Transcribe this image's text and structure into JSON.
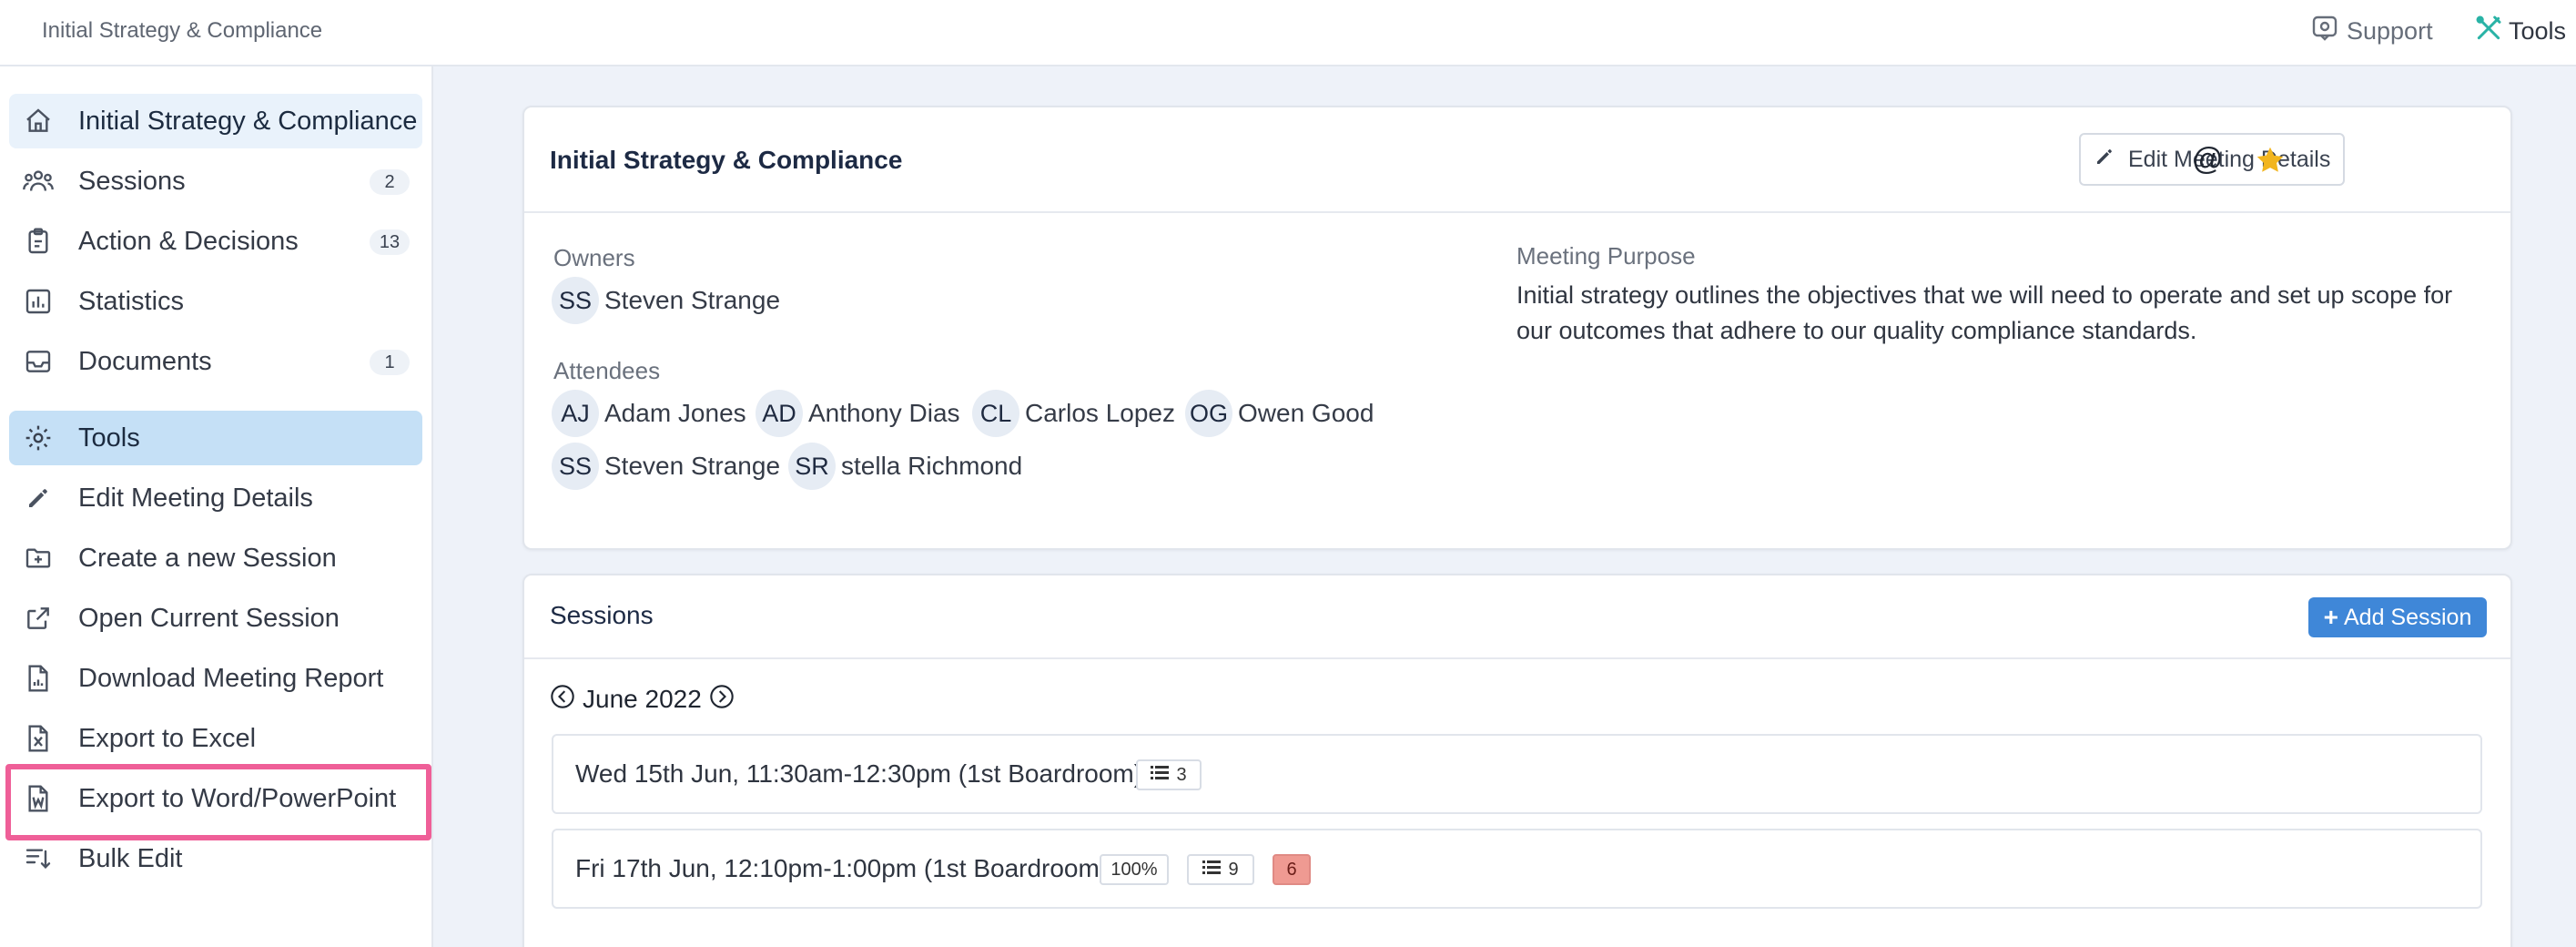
{
  "app": {
    "title": "Initial Strategy & Compliance"
  },
  "topbar": {
    "support_label": "Support",
    "tools_label": "Tools"
  },
  "sidebar": {
    "main_items": [
      {
        "label": "Initial Strategy & Compliance",
        "icon": "home-icon"
      },
      {
        "label": "Sessions",
        "count": "2",
        "icon": "people-icon"
      },
      {
        "label": "Action & Decisions",
        "count": "13",
        "icon": "clipboard-icon"
      },
      {
        "label": "Statistics",
        "icon": "chart-icon"
      },
      {
        "label": "Documents",
        "count": "1",
        "icon": "inbox-icon"
      }
    ],
    "tools_header": {
      "label": "Tools",
      "icon": "gear-icon"
    },
    "tool_items": [
      {
        "label": "Edit Meeting Details",
        "icon": "pencil-icon"
      },
      {
        "label": "Create a new Session",
        "icon": "folder-plus-icon"
      },
      {
        "label": "Open Current Session",
        "icon": "external-link-icon"
      },
      {
        "label": "Download Meeting Report",
        "icon": "report-icon"
      },
      {
        "label": "Export to Excel",
        "icon": "excel-file-icon"
      },
      {
        "label": "Export to Word/PowerPoint",
        "icon": "word-file-icon"
      },
      {
        "label": "Bulk Edit",
        "icon": "sort-list-icon"
      }
    ]
  },
  "meeting": {
    "title": "Initial Strategy & Compliance",
    "edit_button": "Edit Meeting Details",
    "owners_label": "Owners",
    "owners": [
      {
        "initials": "SS",
        "name": "Steven Strange"
      }
    ],
    "attendees_label": "Attendees",
    "attendees": [
      {
        "initials": "AJ",
        "name": "Adam Jones"
      },
      {
        "initials": "AD",
        "name": "Anthony Dias"
      },
      {
        "initials": "CL",
        "name": "Carlos Lopez"
      },
      {
        "initials": "OG",
        "name": "Owen Good"
      },
      {
        "initials": "SS",
        "name": "Steven Strange"
      },
      {
        "initials": "SR",
        "name": "stella Richmond"
      }
    ],
    "purpose_label": "Meeting Purpose",
    "purpose_text": "Initial strategy outlines the objectives that we will need to operate and set up scope for our outcomes that adhere to our quality compliance standards."
  },
  "sessions": {
    "title": "Sessions",
    "add_button": "Add Session",
    "month": "June 2022",
    "rows": [
      {
        "label": "Wed 15th Jun, 11:30am-12:30pm (1st Boardroom)",
        "items": "3"
      },
      {
        "label": "Fri 17th Jun, 12:10pm-1:00pm (1st Boardroom)",
        "progress": "100%",
        "items": "9",
        "alert": "6"
      }
    ]
  },
  "colors": {
    "accent": "#3f87d8",
    "highlight": "#ef5f98",
    "star": "#f2b51f",
    "tools_teal": "#29b3a6"
  }
}
